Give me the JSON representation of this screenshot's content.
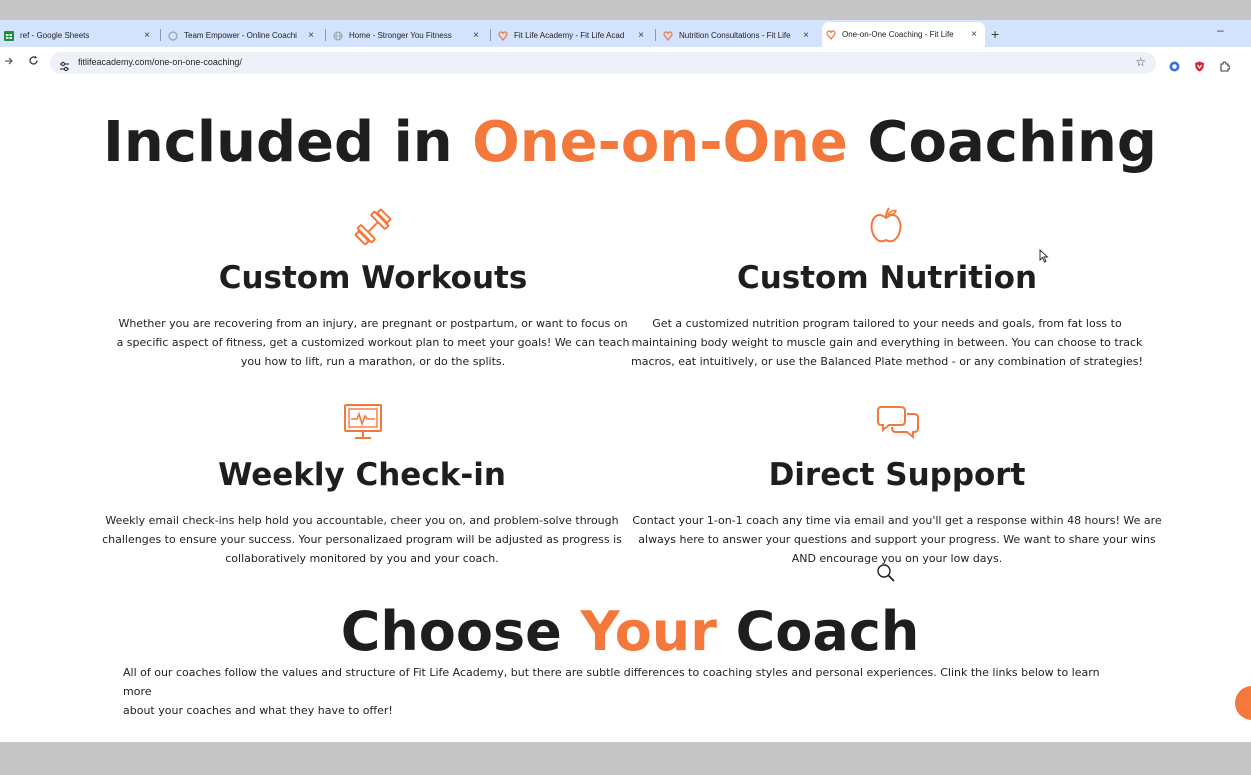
{
  "browser": {
    "tabs": [
      {
        "title": "ref - Google Sheets",
        "icon": "google-sheets-icon"
      },
      {
        "title": "Team Empower - Online Coachi",
        "icon": "loading-icon"
      },
      {
        "title": "Home - Stronger You Fitness",
        "icon": "globe-icon"
      },
      {
        "title": "Fit Life Academy - Fit Life Acad",
        "icon": "fitlife-logo-icon"
      },
      {
        "title": "Nutrition Consultations - Fit Life",
        "icon": "fitlife-logo-icon"
      },
      {
        "title": "One-on-One Coaching - Fit Life",
        "icon": "fitlife-logo-icon",
        "active": true
      }
    ],
    "close_glyph": "×",
    "new_tab_glyph": "+",
    "minimize_glyph": "–",
    "url": "fitlifeacademy.com/one-on-one-coaching/"
  },
  "page": {
    "accent_color": "#f4783b",
    "heading": {
      "before": "Included in ",
      "accent": "One-on-One",
      "after": " Coaching"
    },
    "features": [
      {
        "icon": "dumbbell-icon",
        "title": "Custom Workouts",
        "lines": [
          "Whether you are recovering from an injury, are pregnant or postpartum, or want to focus on",
          "a specific aspect of fitness, get a customized workout plan to meet your goals! We can teach",
          "you how to lift, run a marathon, or do the splits."
        ]
      },
      {
        "icon": "apple-icon",
        "title": "Custom Nutrition",
        "lines": [
          "Get a customized nutrition program tailored to your needs and goals, from fat loss to",
          "maintaining body weight to muscle gain and everything in between. You can choose to track",
          "macros, eat intuitively, or use the Balanced Plate method - or any combination of strategies!"
        ]
      },
      {
        "icon": "monitor-heartbeat-icon",
        "title": "Weekly Check-in",
        "lines": [
          "Weekly email check-ins help hold you accountable, cheer you on, and problem-solve through",
          "challenges to ensure your success. Your personalizaed program will be adjusted as progress is",
          "collaboratively monitored by you and your coach."
        ]
      },
      {
        "icon": "chat-bubbles-icon",
        "title": "Direct Support",
        "lines": [
          "Contact your 1-on-1 coach any time via email and you'll get a response within 48 hours! We are",
          "always here to answer your questions and support your progress. We want to share your wins",
          "AND encourage you on your low days."
        ]
      }
    ],
    "coach_heading": {
      "before": "Choose ",
      "accent": "Your",
      "after": " Coach"
    },
    "coach_intro": [
      "All of our coaches follow the values and structure of Fit Life Academy, but there are subtle differences to coaching styles and personal experiences. Clink the links below to learn more",
      "about your coaches and what they have to offer!"
    ]
  }
}
